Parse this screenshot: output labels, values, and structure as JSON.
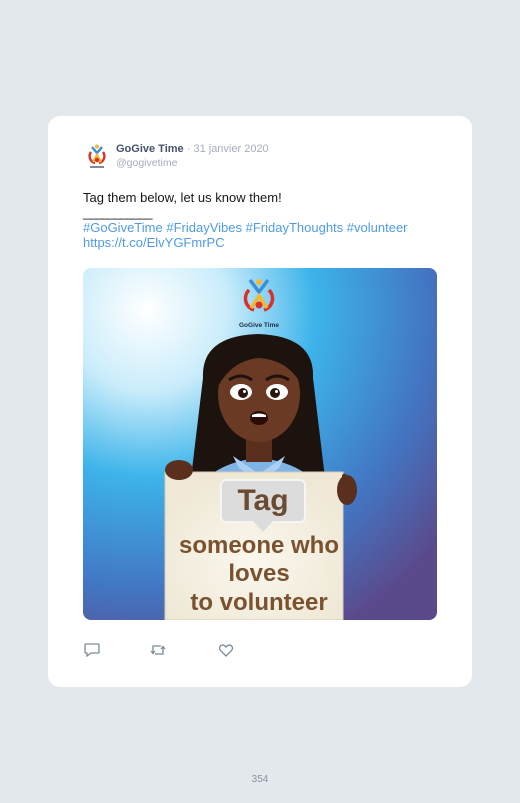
{
  "tweet": {
    "author_name": "GoGive Time",
    "separator": "·",
    "date": "31 janvier 2020",
    "handle": "@gogivetime",
    "text_line1": "Tag them below, let us know them!",
    "text_line2": "___________",
    "hashtags": [
      "#GoGiveTime",
      "#FridayVibes",
      "#FridayThoughts",
      "#volunteer"
    ],
    "link": "https://t.co/ElvYGFmrPC"
  },
  "media": {
    "logo_text": "GoGive Time",
    "sign_bubble": "Tag",
    "sign_line1": "someone who",
    "sign_line2": "loves",
    "sign_line3": "to volunteer"
  },
  "actions": {
    "reply_icon": "reply-icon",
    "retweet_icon": "retweet-icon",
    "like_icon": "heart-icon"
  },
  "footer": {
    "page_number": "354"
  },
  "colors": {
    "link": "#4f9be4",
    "card_bg": "#ffffff",
    "page_bg": "#e3e8ec"
  }
}
